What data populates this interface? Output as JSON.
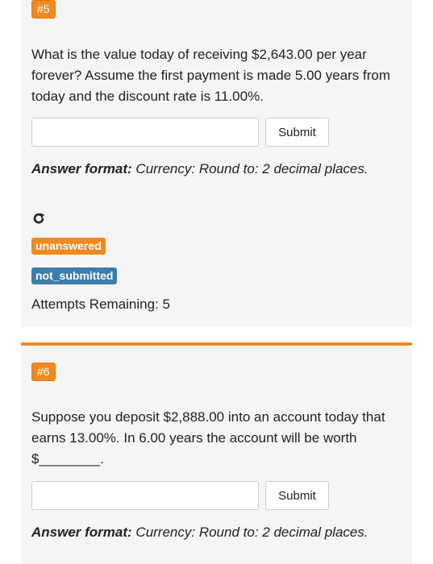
{
  "questions": [
    {
      "number": "#5",
      "text": "What is the value today of receiving $2,643.00 per year forever? Assume the first payment is made 5.00 years from today and the discount rate is 11.00%.",
      "input_value": "",
      "submit_label": "Submit",
      "format_label": "Answer format:",
      "format_text": " Currency: Round to: 2 decimal places.",
      "reload_icon": "reload-icon",
      "status_badge": "unanswered",
      "submission_badge": "not_submitted",
      "attempts_text": "Attempts Remaining: 5"
    },
    {
      "number": "#6",
      "text": "Suppose you deposit $2,888.00 into an account today that earns 13.00%. In 6.00 years the account will be worth $________.",
      "input_value": "",
      "submit_label": "Submit",
      "format_label": "Answer format:",
      "format_text": " Currency: Round to: 2 decimal places."
    }
  ],
  "colors": {
    "accent_orange": "#ef8a22",
    "badge_blue": "#3d7ea8",
    "card_background": "#f5f5f5"
  }
}
